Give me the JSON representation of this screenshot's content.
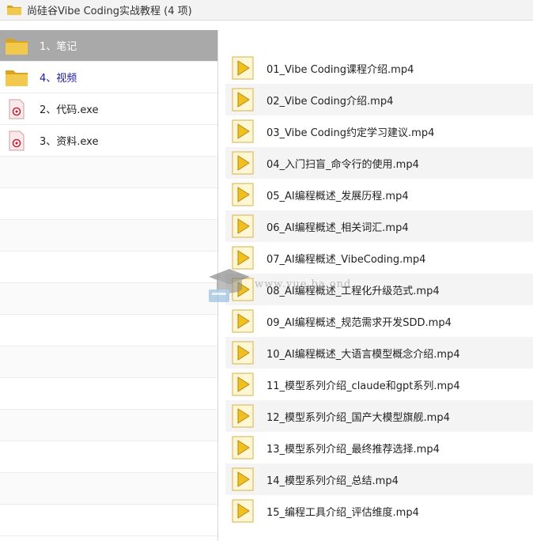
{
  "window": {
    "title": "尚硅谷Vibe Coding实战教程 (4 项)"
  },
  "colors": {
    "folder_yellow": "#f2c94c",
    "folder_dark": "#d9a520",
    "selected_bg": "#a9a9a9",
    "highlight_text": "#1a1aa6",
    "media_yellow": "#f0c020"
  },
  "left_items": [
    {
      "label": "1、笔记",
      "icon": "folder-icon",
      "selected": true
    },
    {
      "label": "4、视频",
      "icon": "folder-icon",
      "highlight": true
    },
    {
      "label": "2、代码.exe",
      "icon": "exe-icon"
    },
    {
      "label": "3、资料.exe",
      "icon": "exe-icon"
    }
  ],
  "files": [
    {
      "name": "01_Vibe Coding课程介绍.mp4"
    },
    {
      "name": "02_Vibe Coding介绍.mp4"
    },
    {
      "name": "03_Vibe Coding约定学习建议.mp4"
    },
    {
      "name": "04_入门扫盲_命令行的使用.mp4"
    },
    {
      "name": "05_AI编程概述_发展历程.mp4"
    },
    {
      "name": "06_AI编程概述_相关词汇.mp4"
    },
    {
      "name": "07_AI编程概述_VibeCoding.mp4"
    },
    {
      "name": "08_AI编程概述_工程化升级范式.mp4"
    },
    {
      "name": "09_AI编程概述_规范需求开发SDD.mp4"
    },
    {
      "name": "10_AI编程概述_大语言模型概念介绍.mp4"
    },
    {
      "name": "11_模型系列介绍_claude和gpt系列.mp4"
    },
    {
      "name": "12_模型系列介绍_国产大模型旗舰.mp4"
    },
    {
      "name": "13_模型系列介绍_最终推荐选择.mp4"
    },
    {
      "name": "14_模型系列介绍_总结.mp4"
    },
    {
      "name": "15_编程工具介绍_评估维度.mp4"
    }
  ],
  "watermark": {
    "text": "www.yue.ba.ond"
  }
}
